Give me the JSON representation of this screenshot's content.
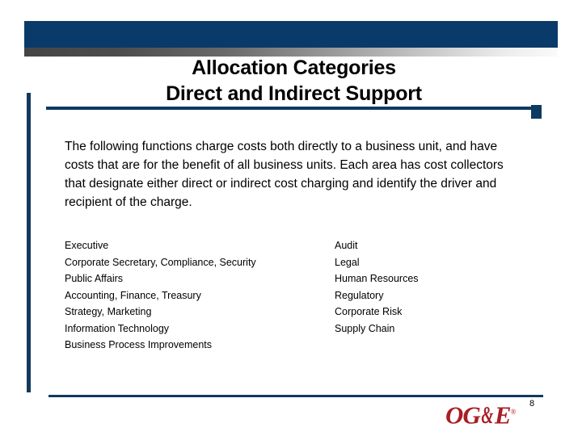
{
  "slide": {
    "page_number": "8",
    "colors": {
      "banner_blue": "#0a3a69",
      "rule_blue": "#0d3a61",
      "logo_red": "#a81e26",
      "gradient_dark": "#454545",
      "gradient_light": "#fafafa",
      "text_black": "#000000",
      "background": "#ffffff"
    }
  },
  "title": {
    "line1": "Allocation Categories",
    "line2": "Direct and Indirect Support"
  },
  "body": {
    "paragraph": "The following functions charge costs both directly to a business unit, and have costs that are for the benefit of all business units.  Each area has cost collectors that designate either direct or indirect cost charging and identify the driver and recipient of the charge."
  },
  "columns": {
    "left": [
      "Executive",
      "Corporate Secretary, Compliance, Security",
      "Public Affairs",
      "Accounting, Finance, Treasury",
      "Strategy, Marketing",
      "Information Technology",
      "Business Process Improvements"
    ],
    "right": [
      "Audit",
      "Legal",
      "Human Resources",
      "Regulatory",
      "Corporate Risk",
      "Supply Chain"
    ]
  },
  "footer": {
    "logo": {
      "part1": "OG",
      "ampersand": "&",
      "part2": "E",
      "trademark": "®"
    }
  }
}
